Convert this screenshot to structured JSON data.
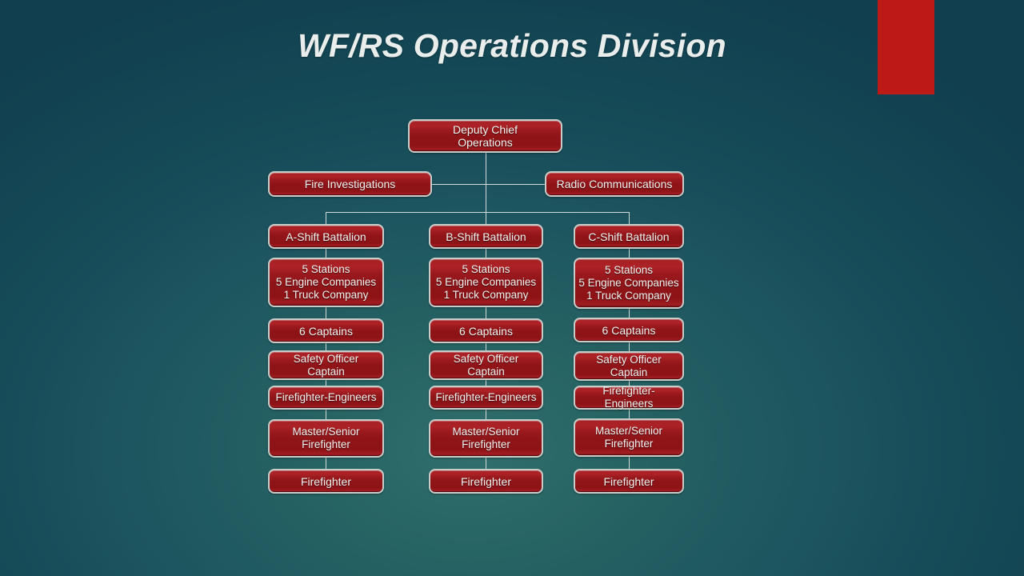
{
  "slide": {
    "title": "WF/RS Operations Division",
    "accent_color": "#bd1a17",
    "background_colors": [
      "#2f6f6d",
      "#1d5560",
      "#113f4f"
    ],
    "node_fill_color": "#8e1418",
    "node_border_color": "#c9cdc9",
    "connector_color": "#d3dcd8",
    "text_color": "#f2f4f2"
  },
  "chart": {
    "type": "org-chart",
    "root": {
      "label": "Deputy Chief\nOperations"
    },
    "staff": [
      {
        "label": "Fire Investigations"
      },
      {
        "label": "Radio Communications"
      }
    ],
    "columns": [
      {
        "key": "a-shift",
        "nodes": [
          {
            "label": "A-Shift Battalion"
          },
          {
            "label": "5 Stations\n5 Engine Companies\n1 Truck Company"
          },
          {
            "label": "6 Captains"
          },
          {
            "label": "Safety Officer\nCaptain"
          },
          {
            "label": "Firefighter-Engineers"
          },
          {
            "label": "Master/Senior\nFirefighter"
          },
          {
            "label": "Firefighter"
          }
        ]
      },
      {
        "key": "b-shift",
        "nodes": [
          {
            "label": "B-Shift Battalion"
          },
          {
            "label": "5 Stations\n5 Engine Companies\n1 Truck Company"
          },
          {
            "label": "6 Captains"
          },
          {
            "label": "Safety Officer\nCaptain"
          },
          {
            "label": "Firefighter-Engineers"
          },
          {
            "label": "Master/Senior\nFirefighter"
          },
          {
            "label": "Firefighter"
          }
        ]
      },
      {
        "key": "c-shift",
        "nodes": [
          {
            "label": "C-Shift Battalion"
          },
          {
            "label": "5 Stations\n5 Engine Companies\n1 Truck Company"
          },
          {
            "label": "6 Captains"
          },
          {
            "label": "Safety Officer\nCaptain"
          },
          {
            "label": "Firefighter-Engineers"
          },
          {
            "label": "Master/Senior\nFirefighter"
          },
          {
            "label": "Firefighter"
          }
        ]
      }
    ]
  }
}
